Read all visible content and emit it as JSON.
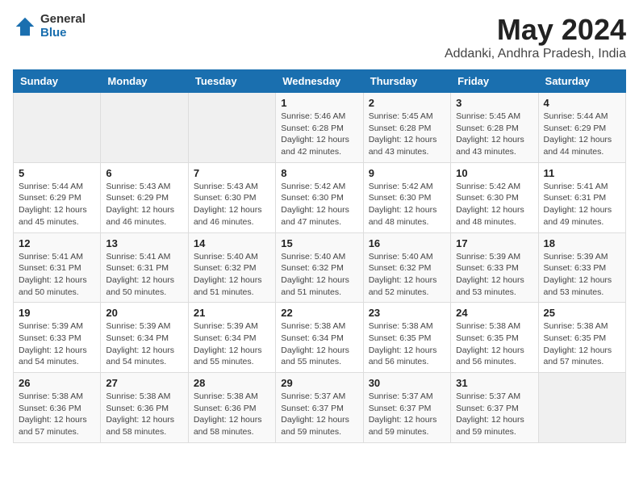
{
  "header": {
    "logo_general": "General",
    "logo_blue": "Blue",
    "month_title": "May 2024",
    "location": "Addanki, Andhra Pradesh, India"
  },
  "weekdays": [
    "Sunday",
    "Monday",
    "Tuesday",
    "Wednesday",
    "Thursday",
    "Friday",
    "Saturday"
  ],
  "weeks": [
    [
      {
        "day": "",
        "sunrise": "",
        "sunset": "",
        "daylight": ""
      },
      {
        "day": "",
        "sunrise": "",
        "sunset": "",
        "daylight": ""
      },
      {
        "day": "",
        "sunrise": "",
        "sunset": "",
        "daylight": ""
      },
      {
        "day": "1",
        "sunrise": "Sunrise: 5:46 AM",
        "sunset": "Sunset: 6:28 PM",
        "daylight": "Daylight: 12 hours and 42 minutes."
      },
      {
        "day": "2",
        "sunrise": "Sunrise: 5:45 AM",
        "sunset": "Sunset: 6:28 PM",
        "daylight": "Daylight: 12 hours and 43 minutes."
      },
      {
        "day": "3",
        "sunrise": "Sunrise: 5:45 AM",
        "sunset": "Sunset: 6:28 PM",
        "daylight": "Daylight: 12 hours and 43 minutes."
      },
      {
        "day": "4",
        "sunrise": "Sunrise: 5:44 AM",
        "sunset": "Sunset: 6:29 PM",
        "daylight": "Daylight: 12 hours and 44 minutes."
      }
    ],
    [
      {
        "day": "5",
        "sunrise": "Sunrise: 5:44 AM",
        "sunset": "Sunset: 6:29 PM",
        "daylight": "Daylight: 12 hours and 45 minutes."
      },
      {
        "day": "6",
        "sunrise": "Sunrise: 5:43 AM",
        "sunset": "Sunset: 6:29 PM",
        "daylight": "Daylight: 12 hours and 46 minutes."
      },
      {
        "day": "7",
        "sunrise": "Sunrise: 5:43 AM",
        "sunset": "Sunset: 6:30 PM",
        "daylight": "Daylight: 12 hours and 46 minutes."
      },
      {
        "day": "8",
        "sunrise": "Sunrise: 5:42 AM",
        "sunset": "Sunset: 6:30 PM",
        "daylight": "Daylight: 12 hours and 47 minutes."
      },
      {
        "day": "9",
        "sunrise": "Sunrise: 5:42 AM",
        "sunset": "Sunset: 6:30 PM",
        "daylight": "Daylight: 12 hours and 48 minutes."
      },
      {
        "day": "10",
        "sunrise": "Sunrise: 5:42 AM",
        "sunset": "Sunset: 6:30 PM",
        "daylight": "Daylight: 12 hours and 48 minutes."
      },
      {
        "day": "11",
        "sunrise": "Sunrise: 5:41 AM",
        "sunset": "Sunset: 6:31 PM",
        "daylight": "Daylight: 12 hours and 49 minutes."
      }
    ],
    [
      {
        "day": "12",
        "sunrise": "Sunrise: 5:41 AM",
        "sunset": "Sunset: 6:31 PM",
        "daylight": "Daylight: 12 hours and 50 minutes."
      },
      {
        "day": "13",
        "sunrise": "Sunrise: 5:41 AM",
        "sunset": "Sunset: 6:31 PM",
        "daylight": "Daylight: 12 hours and 50 minutes."
      },
      {
        "day": "14",
        "sunrise": "Sunrise: 5:40 AM",
        "sunset": "Sunset: 6:32 PM",
        "daylight": "Daylight: 12 hours and 51 minutes."
      },
      {
        "day": "15",
        "sunrise": "Sunrise: 5:40 AM",
        "sunset": "Sunset: 6:32 PM",
        "daylight": "Daylight: 12 hours and 51 minutes."
      },
      {
        "day": "16",
        "sunrise": "Sunrise: 5:40 AM",
        "sunset": "Sunset: 6:32 PM",
        "daylight": "Daylight: 12 hours and 52 minutes."
      },
      {
        "day": "17",
        "sunrise": "Sunrise: 5:39 AM",
        "sunset": "Sunset: 6:33 PM",
        "daylight": "Daylight: 12 hours and 53 minutes."
      },
      {
        "day": "18",
        "sunrise": "Sunrise: 5:39 AM",
        "sunset": "Sunset: 6:33 PM",
        "daylight": "Daylight: 12 hours and 53 minutes."
      }
    ],
    [
      {
        "day": "19",
        "sunrise": "Sunrise: 5:39 AM",
        "sunset": "Sunset: 6:33 PM",
        "daylight": "Daylight: 12 hours and 54 minutes."
      },
      {
        "day": "20",
        "sunrise": "Sunrise: 5:39 AM",
        "sunset": "Sunset: 6:34 PM",
        "daylight": "Daylight: 12 hours and 54 minutes."
      },
      {
        "day": "21",
        "sunrise": "Sunrise: 5:39 AM",
        "sunset": "Sunset: 6:34 PM",
        "daylight": "Daylight: 12 hours and 55 minutes."
      },
      {
        "day": "22",
        "sunrise": "Sunrise: 5:38 AM",
        "sunset": "Sunset: 6:34 PM",
        "daylight": "Daylight: 12 hours and 55 minutes."
      },
      {
        "day": "23",
        "sunrise": "Sunrise: 5:38 AM",
        "sunset": "Sunset: 6:35 PM",
        "daylight": "Daylight: 12 hours and 56 minutes."
      },
      {
        "day": "24",
        "sunrise": "Sunrise: 5:38 AM",
        "sunset": "Sunset: 6:35 PM",
        "daylight": "Daylight: 12 hours and 56 minutes."
      },
      {
        "day": "25",
        "sunrise": "Sunrise: 5:38 AM",
        "sunset": "Sunset: 6:35 PM",
        "daylight": "Daylight: 12 hours and 57 minutes."
      }
    ],
    [
      {
        "day": "26",
        "sunrise": "Sunrise: 5:38 AM",
        "sunset": "Sunset: 6:36 PM",
        "daylight": "Daylight: 12 hours and 57 minutes."
      },
      {
        "day": "27",
        "sunrise": "Sunrise: 5:38 AM",
        "sunset": "Sunset: 6:36 PM",
        "daylight": "Daylight: 12 hours and 58 minutes."
      },
      {
        "day": "28",
        "sunrise": "Sunrise: 5:38 AM",
        "sunset": "Sunset: 6:36 PM",
        "daylight": "Daylight: 12 hours and 58 minutes."
      },
      {
        "day": "29",
        "sunrise": "Sunrise: 5:37 AM",
        "sunset": "Sunset: 6:37 PM",
        "daylight": "Daylight: 12 hours and 59 minutes."
      },
      {
        "day": "30",
        "sunrise": "Sunrise: 5:37 AM",
        "sunset": "Sunset: 6:37 PM",
        "daylight": "Daylight: 12 hours and 59 minutes."
      },
      {
        "day": "31",
        "sunrise": "Sunrise: 5:37 AM",
        "sunset": "Sunset: 6:37 PM",
        "daylight": "Daylight: 12 hours and 59 minutes."
      },
      {
        "day": "",
        "sunrise": "",
        "sunset": "",
        "daylight": ""
      }
    ]
  ]
}
